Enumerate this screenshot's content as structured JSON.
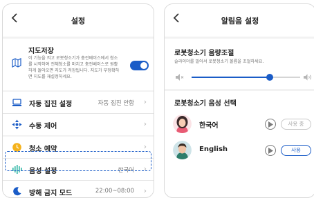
{
  "settings_screen": {
    "title": "설정",
    "back_icon": "chevron-left-icon",
    "map_save": {
      "title": "지도저장",
      "description": "이 기능을 켜고 로봇청소기가 충전베이스에서 청소를 시작하여 전체청소를 마치고 충전베이스로 원활하게 돌아오면 지도가 저장됩니다. 지도가 부정확하면 지도를 재설정하세요.",
      "icon": "map-icon",
      "toggle_on": true,
      "accent_color": "#1a5cc7"
    },
    "items": [
      {
        "label": "자동 집진 설정",
        "value": "자동 집진 안함",
        "icon": "dust-bin-icon"
      },
      {
        "label": "수동 제어",
        "value": "",
        "icon": "dpad-icon"
      },
      {
        "label": "청소 예약",
        "value": "",
        "icon": "clock-icon"
      },
      {
        "label": "음성 설정",
        "value": "한국어",
        "icon": "sound-wave-icon",
        "highlighted": true
      },
      {
        "label": "방해 금지 모드",
        "value": "22:00~08:00",
        "icon": "moon-icon"
      }
    ]
  },
  "sound_screen": {
    "title": "알림음 설정",
    "back_icon": "chevron-left-icon",
    "volume": {
      "title": "로봇청소기 음량조절",
      "description": "슬라이더를 밀어서 로봇청소기 볼륨을 조절하세요.",
      "level": 0.72,
      "low_icon": "speaker-low-icon",
      "high_icon": "speaker-high-icon"
    },
    "voice": {
      "title": "로봇청소기 음성 선택",
      "options": [
        {
          "name": "한국어",
          "button": "사용 중",
          "state": "in-use",
          "avatar": "woman-avatar"
        },
        {
          "name": "English",
          "button": "사용",
          "state": "available",
          "avatar": "man-avatar"
        }
      ]
    }
  }
}
